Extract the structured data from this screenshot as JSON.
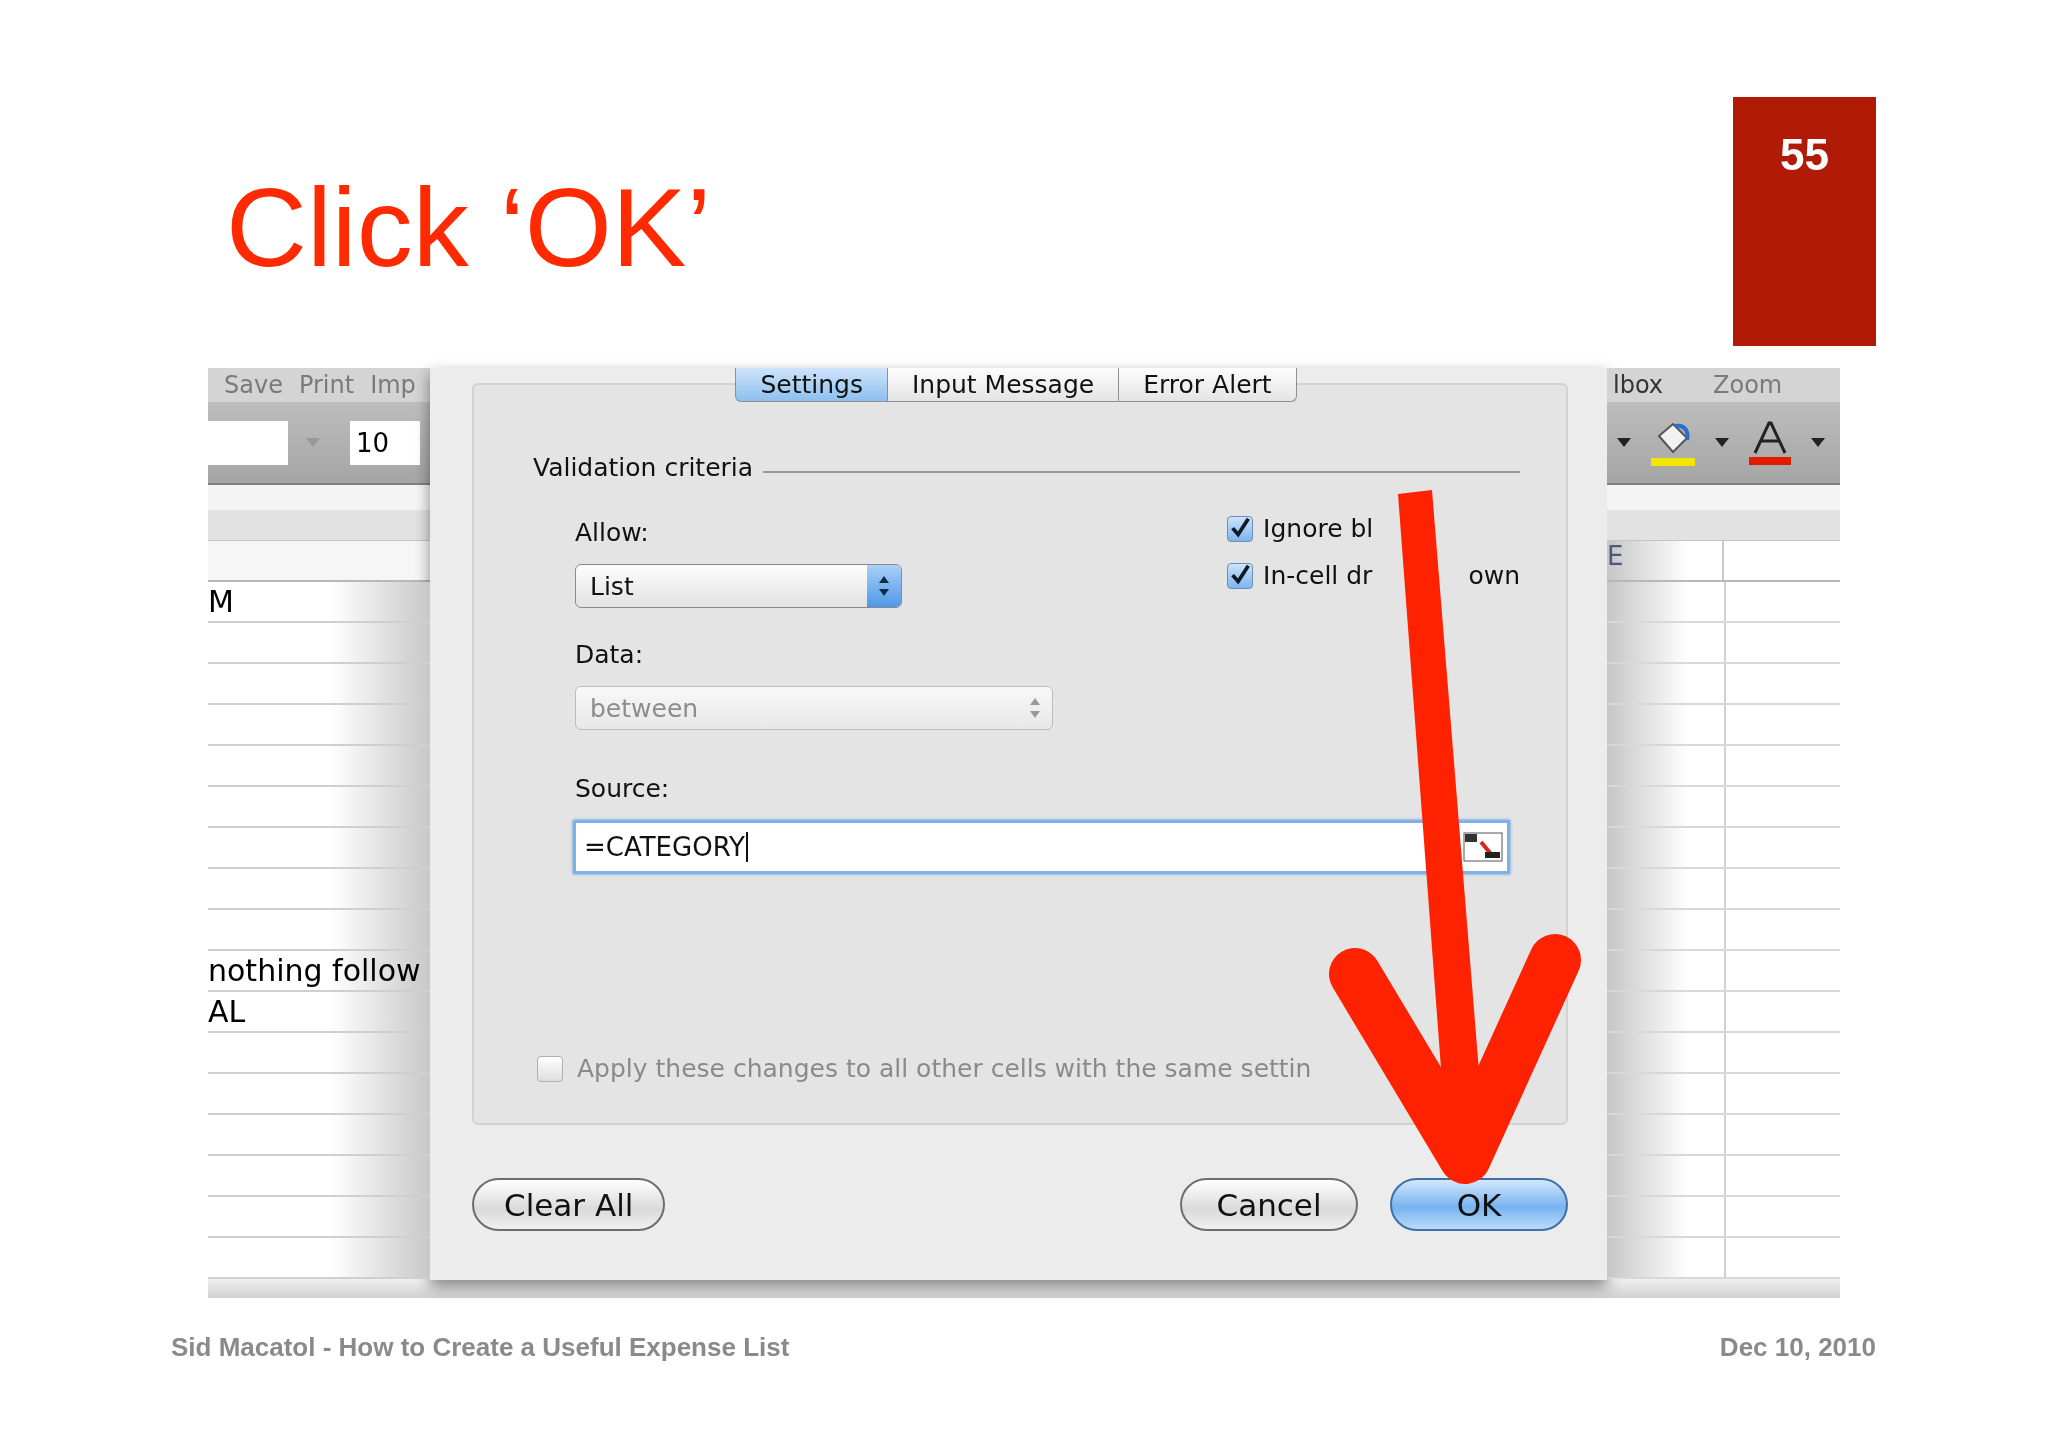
{
  "slide": {
    "title": "Click ‘OK’",
    "page_number": "55"
  },
  "spreadsheet": {
    "toolbar_left": [
      "Save",
      "Print",
      "Imp"
    ],
    "toolbar_right": [
      "lbox",
      "Zoom"
    ],
    "font_size": "10",
    "column_header": "E",
    "cells": [
      {
        "text": "M"
      },
      {
        "text": "nothing follow"
      },
      {
        "text": "AL"
      }
    ]
  },
  "dialog": {
    "tabs": [
      {
        "label": "Settings",
        "selected": true
      },
      {
        "label": "Input Message",
        "selected": false
      },
      {
        "label": "Error Alert",
        "selected": false
      }
    ],
    "section_title": "Validation criteria",
    "allow_label": "Allow:",
    "allow_value": "List",
    "data_label": "Data:",
    "data_value": "between",
    "data_disabled": true,
    "source_label": "Source:",
    "source_value": "=CATEGORY",
    "options": [
      {
        "label": "Ignore bl",
        "checked": true
      },
      {
        "label": "In-cell dr",
        "label_end": "own",
        "checked": true
      }
    ],
    "apply": {
      "label": "Apply these changes to all other cells with the same settin",
      "checked": false,
      "disabled": true
    },
    "buttons": [
      {
        "label": "Clear All",
        "default": false
      },
      {
        "label": "Cancel",
        "default": false
      },
      {
        "label": "OK",
        "default": true
      }
    ]
  },
  "footer": {
    "left": "Sid Macatol - How to Create a Useful Expense List",
    "right": "Dec 10, 2010"
  }
}
